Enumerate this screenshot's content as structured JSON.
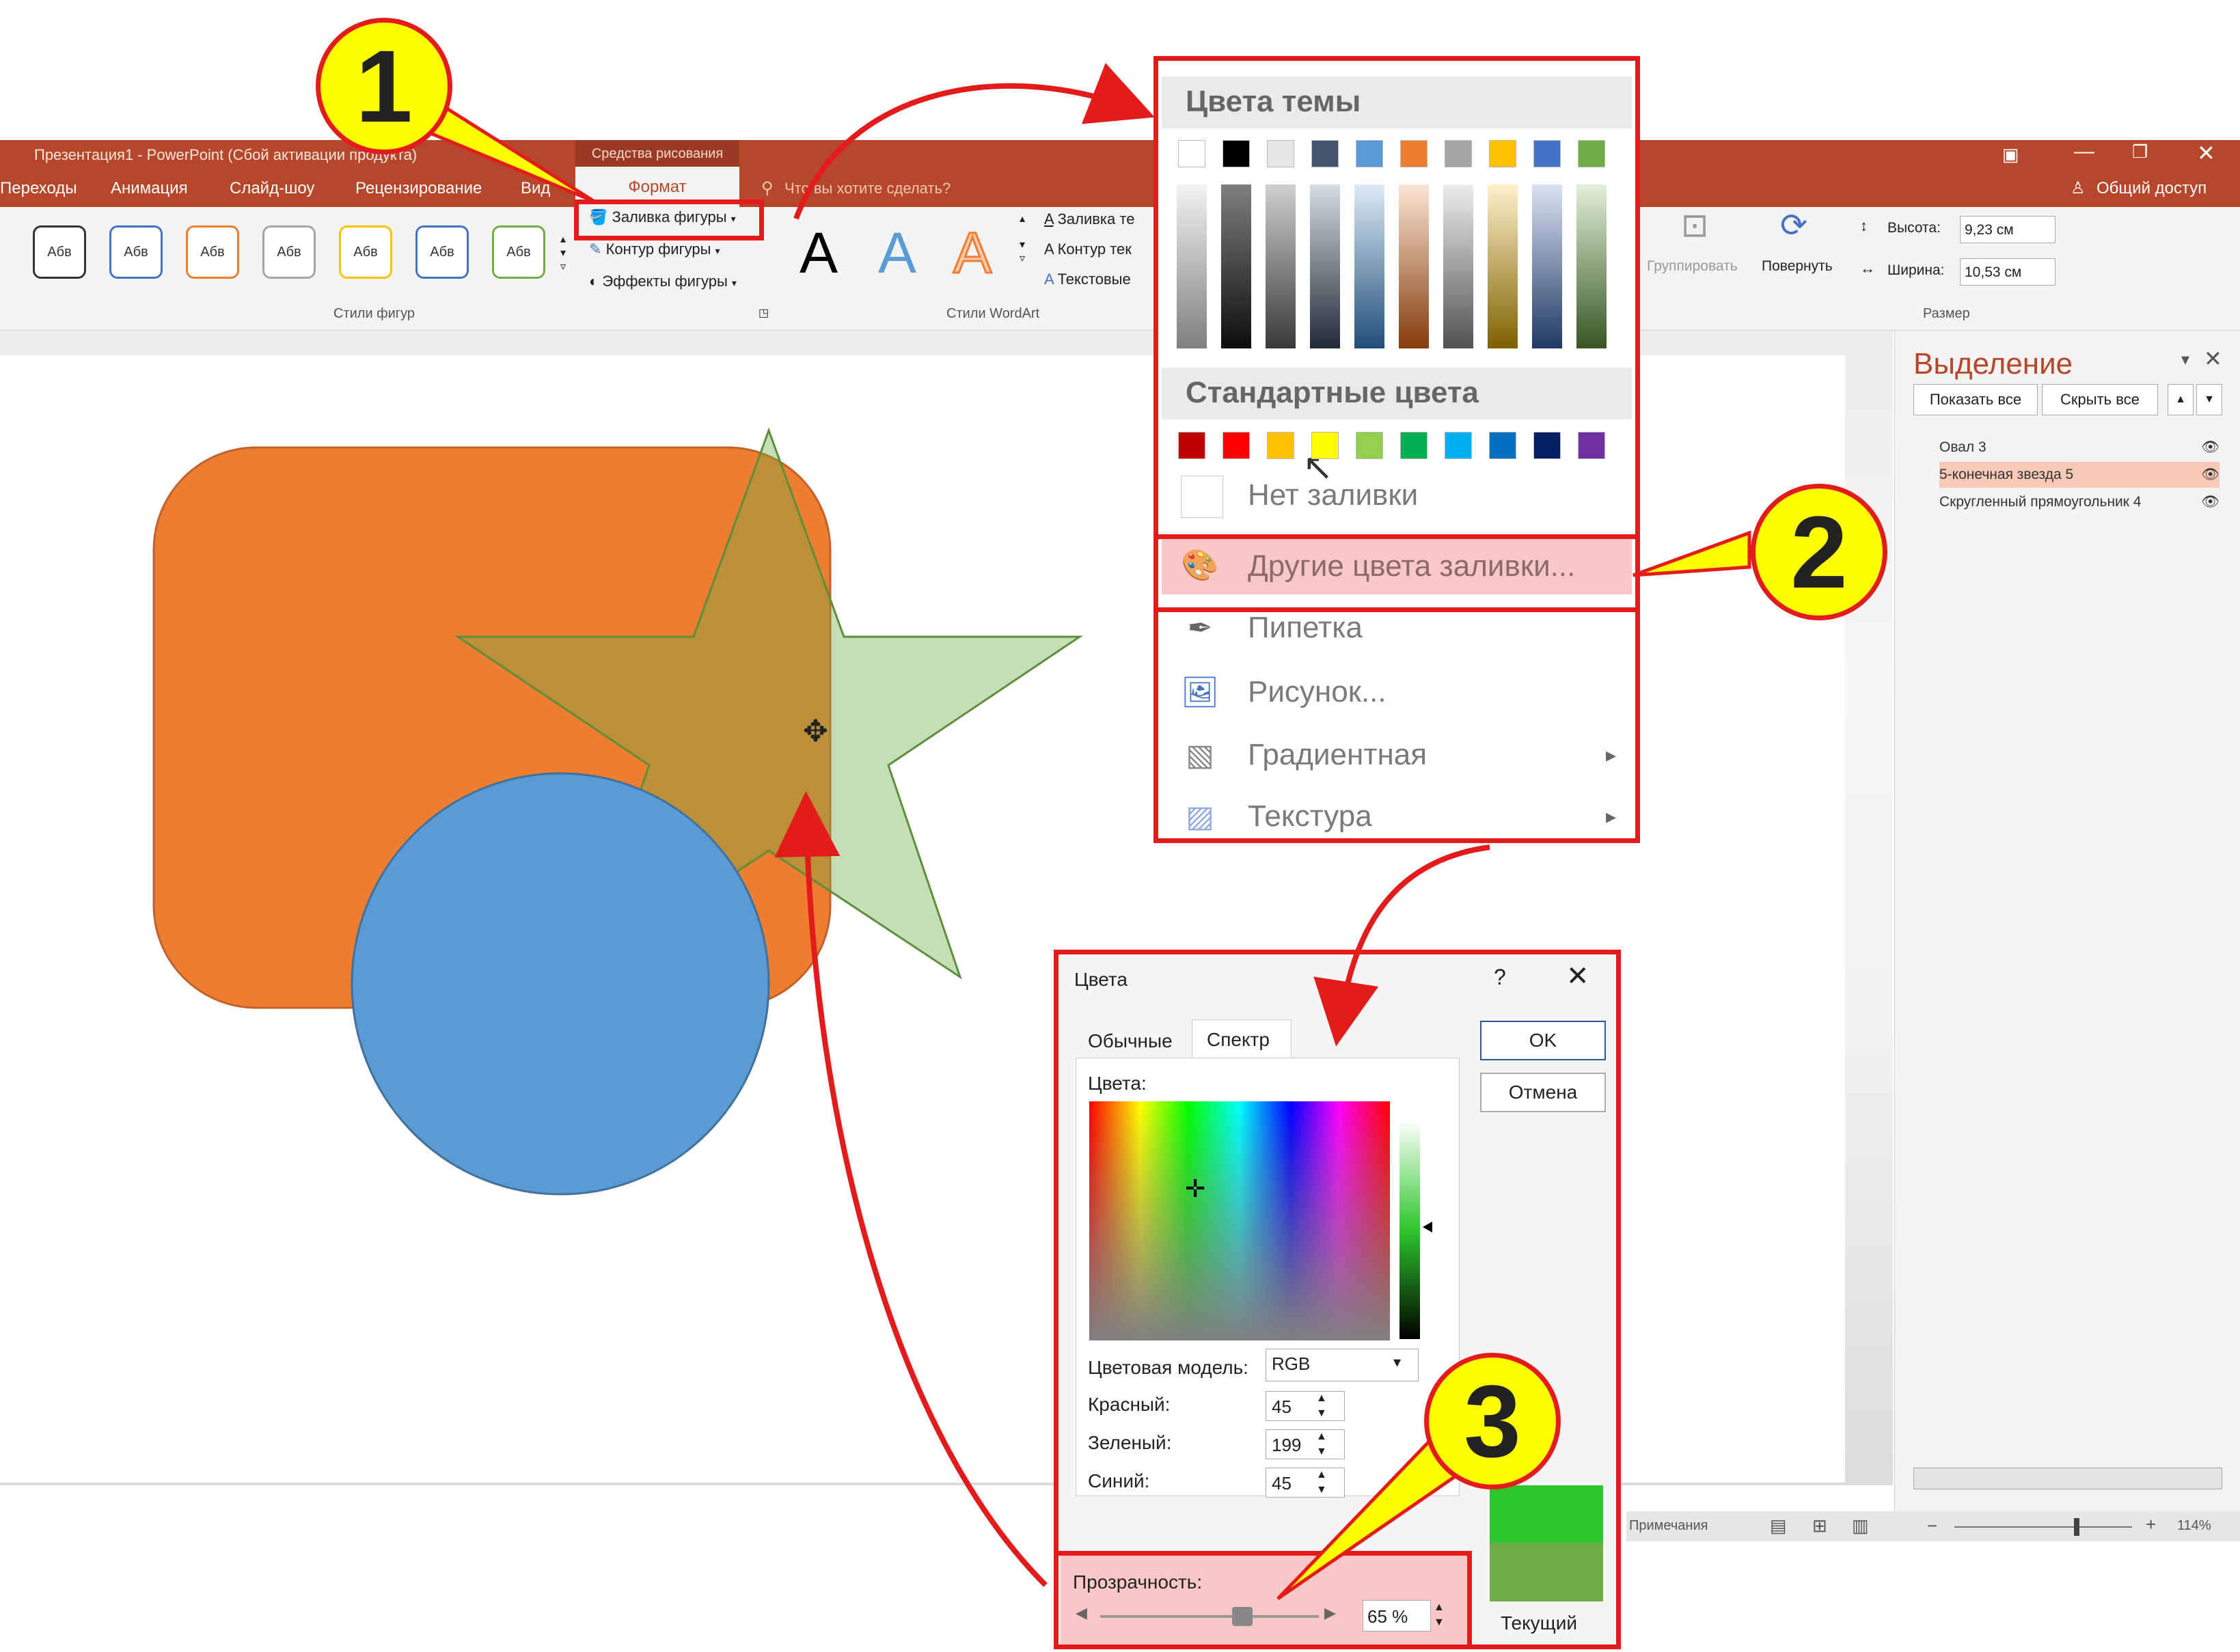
{
  "window": {
    "title": "Презентация1 - PowerPoint (Сбой активации продукта)",
    "contextual_tools_label": "Средства рисования",
    "share_label": "Общий доступ"
  },
  "tabs": [
    "Переходы",
    "Анимация",
    "Слайд-шоу",
    "Рецензирование",
    "Вид"
  ],
  "active_tab": "Формат",
  "tell_me_placeholder": "Что вы хотите сделать?",
  "ribbon": {
    "shape_style_label": "Абв",
    "shape_fill": "Заливка фигуры",
    "shape_outline": "Контур фигуры",
    "shape_effects": "Эффекты фигуры",
    "group_shape_styles": "Стили фигур",
    "wordart_letter": "A",
    "text_fill": "Заливка те",
    "text_outline": "Контур тек",
    "text_effects": "Текстовые",
    "group_wordart": "Стили WordArt",
    "group_btn": "Группировать",
    "rotate_btn": "Повернуть",
    "height_label": "Высота:",
    "height_value": "9,23 см",
    "width_label": "Ширина:",
    "width_value": "10,53 см",
    "group_size": "Размер"
  },
  "selection_pane": {
    "title": "Выделение",
    "show_all": "Показать все",
    "hide_all": "Скрыть все",
    "items": [
      "Овал 3",
      "5-конечная звезда 5",
      "Скругленный прямоугольник 4"
    ],
    "selected_index": 1
  },
  "status_bar": {
    "notes": "Примечания",
    "zoom": "114%"
  },
  "fill_menu": {
    "theme_colors_label": "Цвета темы",
    "standard_colors_label": "Стандартные цвета",
    "no_fill": "Нет заливки",
    "more_colors": "Другие цвета заливки...",
    "eyedropper": "Пипетка",
    "picture": "Рисунок...",
    "gradient": "Градиентная",
    "texture": "Текстура",
    "theme_top_row": [
      "#ffffff",
      "#000000",
      "#e7e6e6",
      "#44546a",
      "#5b9bd5",
      "#ed7d31",
      "#a5a5a5",
      "#ffc000",
      "#4472c4",
      "#70ad47"
    ],
    "standard_row": [
      "#c00000",
      "#ff0000",
      "#ffc000",
      "#ffff00",
      "#92d050",
      "#00b050",
      "#00b0f0",
      "#0070c0",
      "#002060",
      "#7030a0"
    ]
  },
  "colors_dialog": {
    "title": "Цвета",
    "help": "?",
    "tab_standard": "Обычные",
    "tab_custom": "Спектр",
    "colors_label": "Цвета:",
    "model_label": "Цветовая модель:",
    "model_value": "RGB",
    "red_label": "Красный:",
    "red_value": "45",
    "green_label": "Зеленый:",
    "green_value": "199",
    "blue_label": "Синий:",
    "blue_value": "45",
    "transparency_label": "Прозрачность:",
    "transparency_value": "65 %",
    "transparency_fraction": 0.65,
    "ok": "OK",
    "cancel": "Отмена",
    "current_label": "Текущий",
    "new_color": "#2dc72d",
    "current_color": "#70ad47"
  },
  "shapes": {
    "rectangle_color": "#ed7d31",
    "circle_color": "#5b9bd5",
    "star_color": "#a5d8a0"
  },
  "callouts": [
    "1",
    "2",
    "3"
  ]
}
